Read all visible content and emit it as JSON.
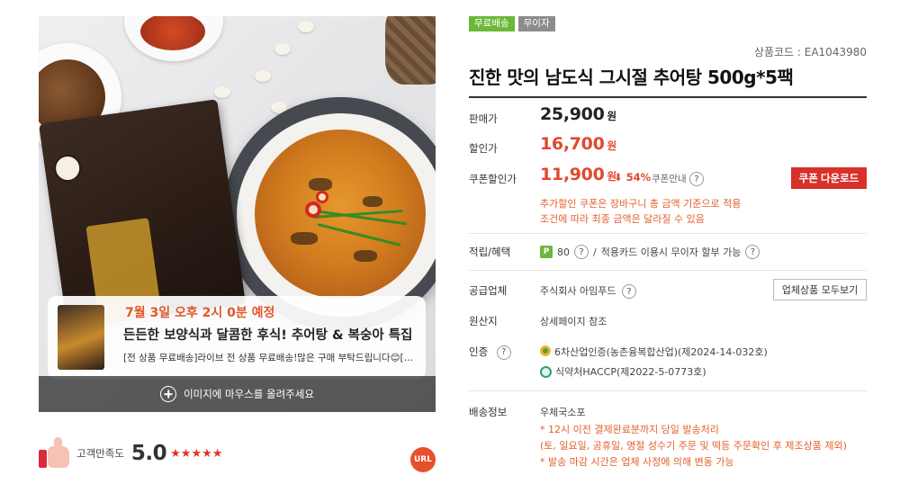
{
  "product_image": {
    "banner": {
      "date_text": "7월 3일 오후 2시 0분 예정",
      "title_text": "든든한 보양식과 달콤한 후식! 추어탕 & 복숭아 특집",
      "desc_text": "[전 상품 무료배송]라이브 전 상품 무료배송!많은 구매 부탁드립니다😊[최..."
    },
    "hover_hint": "이미지에 마우스를 올려주세요"
  },
  "rating": {
    "label": "고객만족도",
    "score": "5.0",
    "stars": "★★★★★"
  },
  "url_button": "URL",
  "tags": [
    "무료배송",
    "무이자"
  ],
  "product_code": "상품코드 : EA1043980",
  "title": "진한 맛의 남도식 그시절 추어탕 500g*5팩",
  "prices": {
    "sale_label": "판매가",
    "sale_value": "25,900",
    "discount_label": "할인가",
    "discount_value": "16,700",
    "coupon_label": "쿠폰할인가",
    "coupon_value": "11,900",
    "won": "원",
    "coupon_pct": "⬇ 54%",
    "coupon_guide": "쿠폰안내",
    "coupon_button": "쿠폰 다운로드",
    "coupon_note_1": "추가할인 쿠폰은 장바구니 총 금액 기준으로 적용",
    "coupon_note_2": "조건에 따라 최종 금액은 달라질 수 있음"
  },
  "benefits": {
    "label": "적립/혜택",
    "point_badge": "P",
    "points": "80",
    "slash": "/",
    "card_text": "적용카드 이용시 무이자 할부 가능"
  },
  "supplier": {
    "label": "공급업체",
    "name": "주식회사 아임푸드",
    "button": "업체상품 모두보기"
  },
  "origin": {
    "label": "원산지",
    "value": "상세페이지 참조"
  },
  "certification": {
    "label": "인증",
    "item_1": "6차산업인증(농촌융복합산업)(제2024-14-032호)",
    "item_2": "식약처HACCP(제2022-5-0773호)"
  },
  "shipping": {
    "label": "배송정보",
    "method": "우체국소포",
    "note_1": "* 12시 이전 결제완료분까지 당일 발송처리",
    "note_2": "(토, 일요일, 공휴일, 명절 성수기 주문 및 떡등 주문확인 후 제조상품 제외)",
    "note_3": "* 발송 마감 시간은 업체 사정에 의해 변동 가능"
  },
  "colors": {
    "accent_red": "#d8312a",
    "price_red": "#e2472f",
    "note_orange": "#e2612f",
    "tag_green": "#6cb838",
    "tag_gray": "#8c8c8c"
  }
}
